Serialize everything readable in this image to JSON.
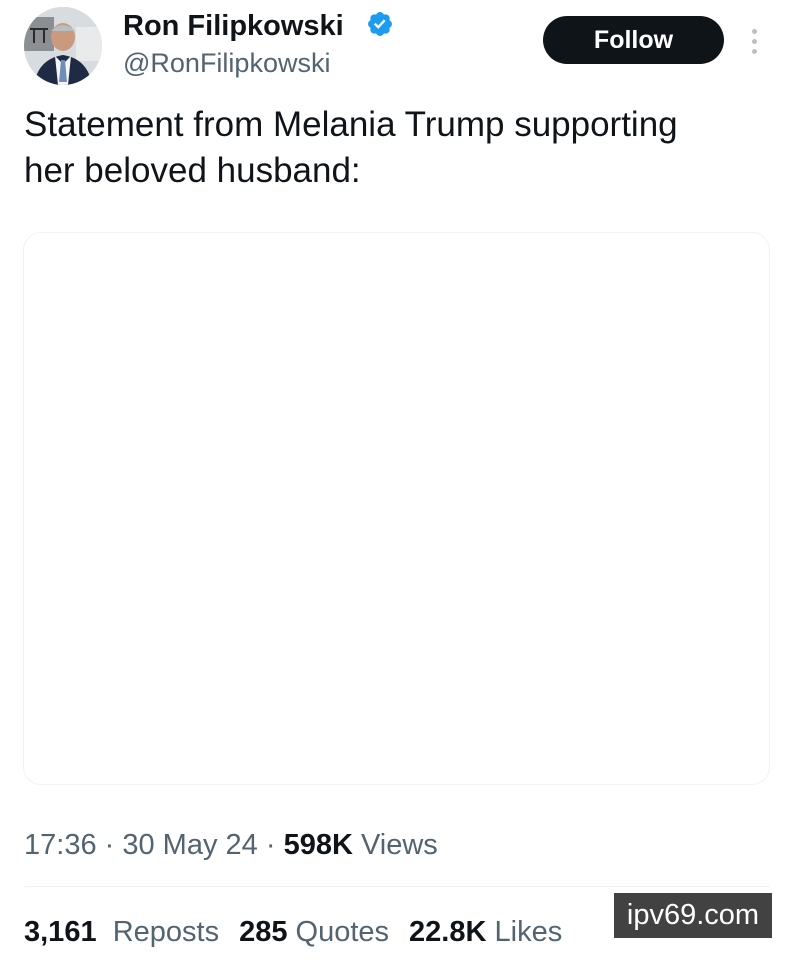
{
  "author": {
    "name": "Ron Filipkowski",
    "handle": "@RonFilipkowski",
    "verified_icon": "verified-badge-icon",
    "verified_color": "#1d9bf0"
  },
  "actions": {
    "follow_label": "Follow",
    "more_icon": "more-vertical-icon"
  },
  "tweet": {
    "text_line1": "Statement from Melania Trump supporting",
    "text_line2": "her beloved husband:"
  },
  "meta": {
    "time": "17:36",
    "sep1": " · ",
    "date": "30 May 24",
    "sep2": " · ",
    "views_count": "598K",
    "views_label": " Views"
  },
  "stats": {
    "reposts_count": "3,161",
    "reposts_label": "Reposts",
    "quotes_count": "285",
    "quotes_label": "Quotes",
    "likes_count": "22.8K",
    "likes_label": "Likes"
  },
  "watermark": "ipv69.com",
  "colors": {
    "text_primary": "#0f1419",
    "text_secondary": "#536471",
    "button_bg": "#0f1419",
    "border": "#eff3f4"
  }
}
